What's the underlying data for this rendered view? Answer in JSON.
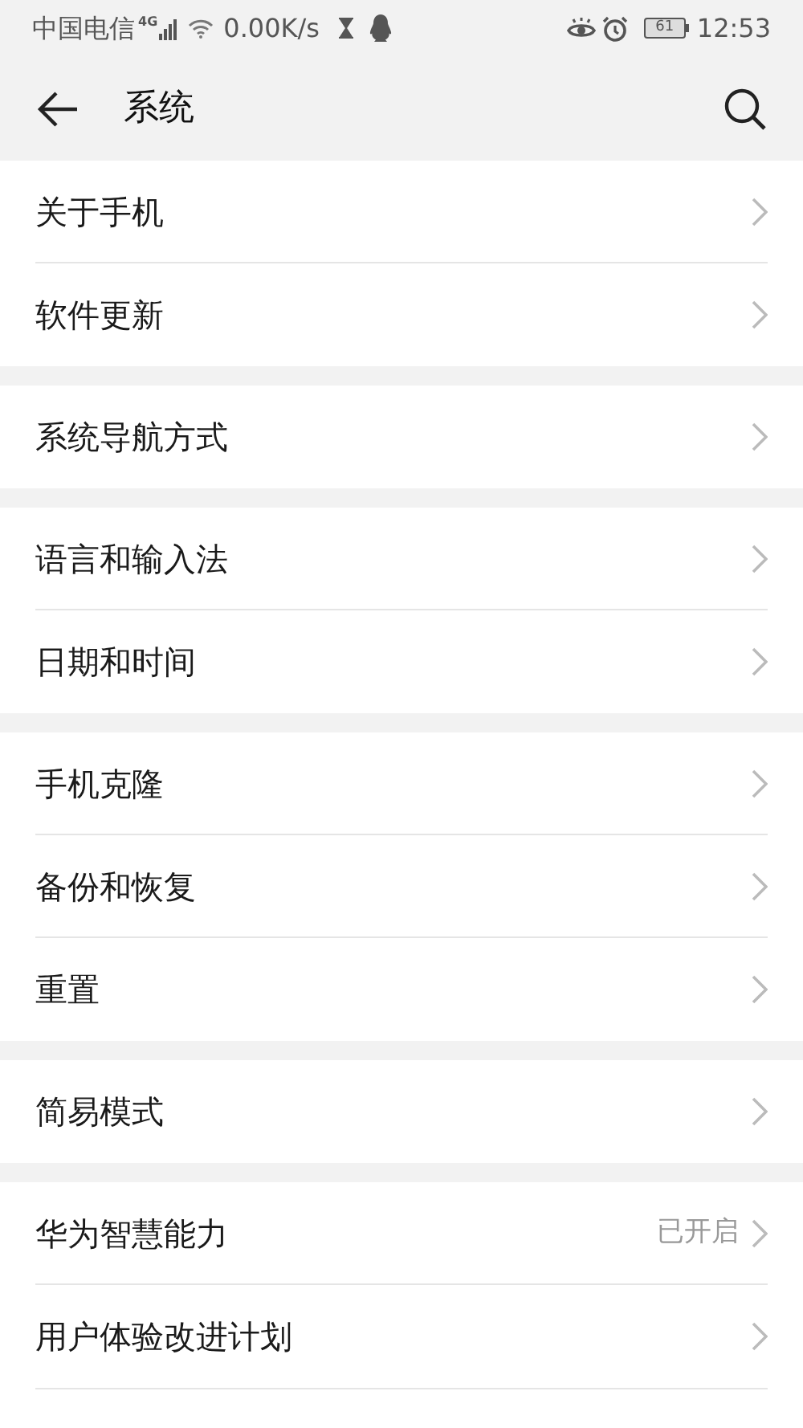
{
  "status_bar": {
    "carrier": "中国电信",
    "network": "4G",
    "speed": "0.00K/s",
    "battery": "61",
    "time": "12:53"
  },
  "header": {
    "title": "系统"
  },
  "groups": [
    {
      "items": [
        {
          "label": "关于手机"
        },
        {
          "label": "软件更新"
        }
      ]
    },
    {
      "items": [
        {
          "label": "系统导航方式"
        }
      ]
    },
    {
      "items": [
        {
          "label": "语言和输入法"
        },
        {
          "label": "日期和时间"
        }
      ]
    },
    {
      "items": [
        {
          "label": "手机克隆"
        },
        {
          "label": "备份和恢复"
        },
        {
          "label": "重置"
        }
      ]
    },
    {
      "items": [
        {
          "label": "简易模式"
        }
      ]
    },
    {
      "items": [
        {
          "label": "华为智慧能力",
          "value": "已开启"
        },
        {
          "label": "用户体验改进计划"
        }
      ]
    }
  ]
}
